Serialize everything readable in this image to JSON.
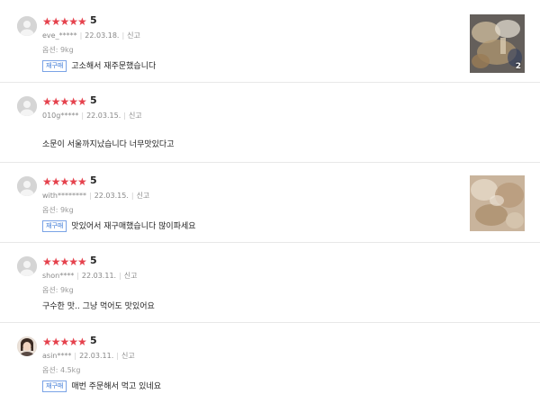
{
  "score_label": "5",
  "report_label": "신고",
  "reviews": [
    {
      "stars": "★★★★★",
      "user": "eve_*****",
      "date": "22.03.18.",
      "option": "옵션: 9kg",
      "badge": "재구매",
      "text": "고소해서 재주문했습니다",
      "has_photo": true,
      "photo_count": "2"
    },
    {
      "stars": "★★★★★",
      "user": "010g*****",
      "date": "22.03.15.",
      "option": "",
      "badge": "",
      "text": "소문이 서울까지났습니다 너무맛있다고",
      "has_photo": false
    },
    {
      "stars": "★★★★★",
      "user": "with********",
      "date": "22.03.15.",
      "option": "옵션: 9kg",
      "badge": "재구매",
      "text": "맛있어서 재구매했습니다 많이파세요",
      "has_photo": true
    },
    {
      "stars": "★★★★★",
      "user": "shon****",
      "date": "22.03.11.",
      "option": "옵션: 9kg",
      "badge": "",
      "text": "구수한 맛.. 그냥 먹어도 맛있어요",
      "has_photo": false
    },
    {
      "stars": "★★★★★",
      "user": "asin****",
      "date": "22.03.11.",
      "option": "옵션: 4.5kg",
      "badge": "재구매",
      "text": "매번 주문해서 먹고 있네요",
      "has_photo": false
    }
  ]
}
